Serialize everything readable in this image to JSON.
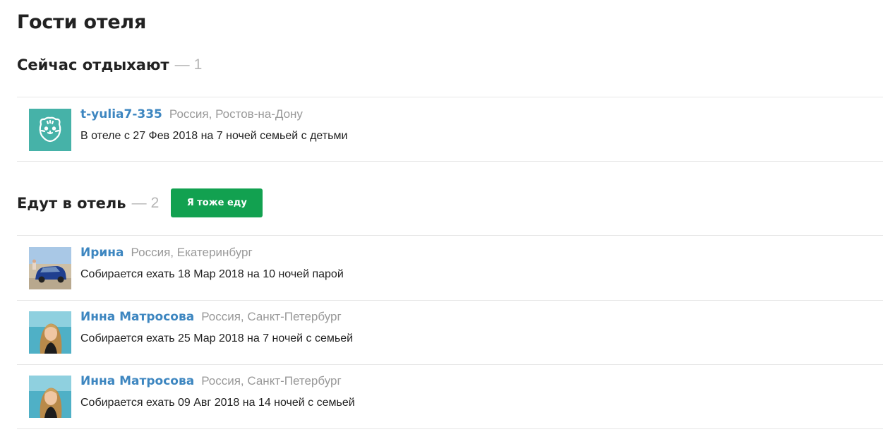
{
  "page": {
    "title": "Гости отеля"
  },
  "now": {
    "title": "Сейчас отдыхают",
    "count_dash": "—",
    "count": "1",
    "guests": [
      {
        "name": "t-yulia7-335",
        "location": "Россия, Ростов-на-Дону",
        "status": "В отеле с 27 Фев 2018 на 7 ночей семьей с детьми",
        "avatar": "tiger-avatar-icon"
      }
    ]
  },
  "going": {
    "title": "Едут в отель",
    "count_dash": "—",
    "count": "2",
    "button_label": "Я тоже еду",
    "guests": [
      {
        "name": "Ирина",
        "location": "Россия, Екатеринбург",
        "status": "Собирается ехать 18 Мар 2018 на 10 ночей парой",
        "avatar": "car-photo"
      },
      {
        "name": "Инна Матросова",
        "location": "Россия, Санкт-Петербург",
        "status": "Собирается ехать 25 Мар 2018 на 7 ночей с семьей",
        "avatar": "portrait-photo"
      },
      {
        "name": "Инна Матросова",
        "location": "Россия, Санкт-Петербург",
        "status": "Собирается ехать 09 Авг 2018 на 14 ночей с семьей",
        "avatar": "portrait-photo"
      }
    ]
  },
  "colors": {
    "accent_link": "#3d86c0",
    "button_green": "#12a150",
    "muted": "#999999",
    "divider": "#e6e6e6"
  }
}
